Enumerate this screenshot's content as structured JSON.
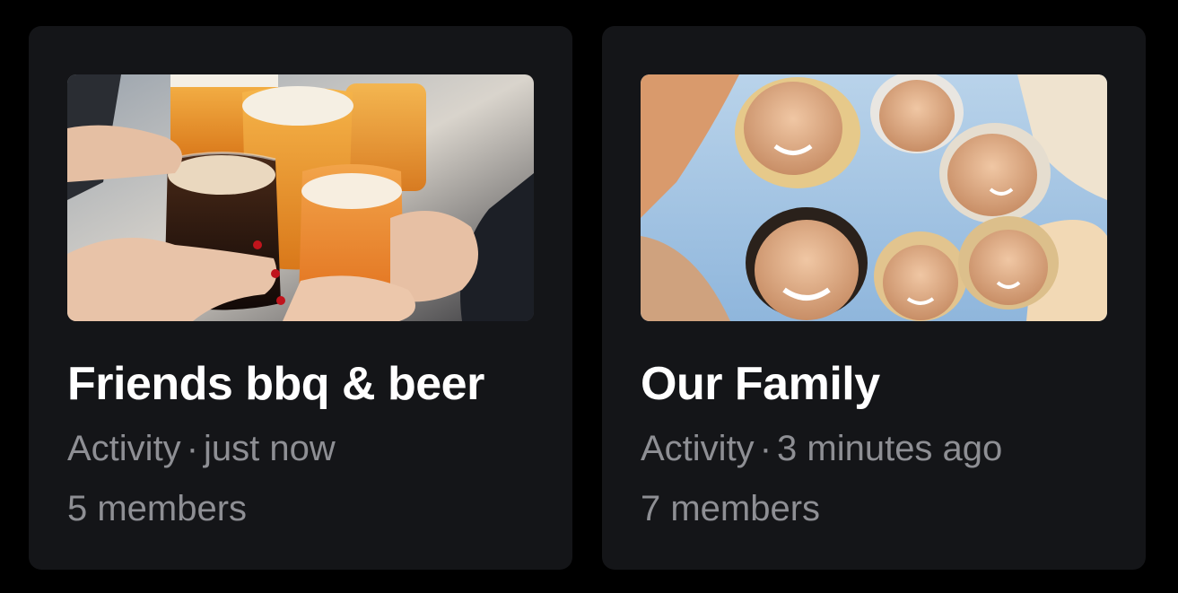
{
  "groups": [
    {
      "title": "Friends bbq & beer",
      "activity_label": "Activity",
      "separator": "·",
      "activity_time": "just now",
      "members": "5 members",
      "image_description": "beer-glasses-cheers-photo"
    },
    {
      "title": "Our Family",
      "activity_label": "Activity",
      "separator": "·",
      "activity_time": "3 minutes ago",
      "members": "7 members",
      "image_description": "family-huddle-photo"
    }
  ],
  "colors": {
    "background": "#000000",
    "card": "#141518",
    "title": "#ffffff",
    "muted": "#8e8f94"
  }
}
